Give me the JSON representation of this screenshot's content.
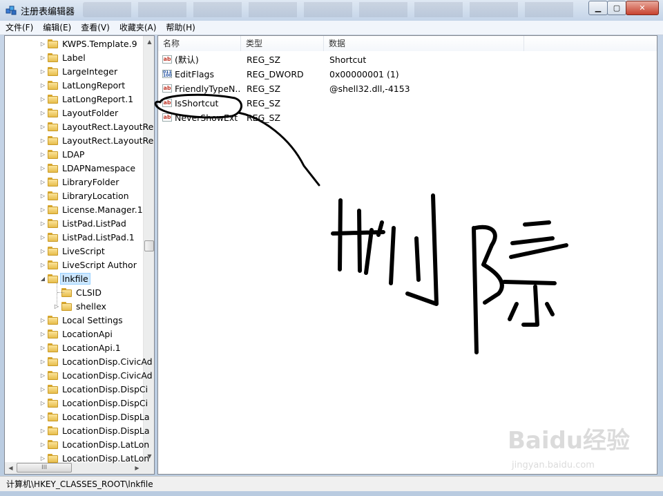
{
  "window": {
    "title": "注册表编辑器",
    "controls": {
      "minimize": "▁",
      "maximize": "▢",
      "close": "✕"
    }
  },
  "menu": [
    "文件(F)",
    "编辑(E)",
    "查看(V)",
    "收藏夹(A)",
    "帮助(H)"
  ],
  "tree": {
    "items": [
      {
        "label": "KWPS.Template.9"
      },
      {
        "label": "Label"
      },
      {
        "label": "LargeInteger"
      },
      {
        "label": "LatLongReport"
      },
      {
        "label": "LatLongReport.1"
      },
      {
        "label": "LayoutFolder"
      },
      {
        "label": "LayoutRect.LayoutRe"
      },
      {
        "label": "LayoutRect.LayoutRe"
      },
      {
        "label": "LDAP"
      },
      {
        "label": "LDAPNamespace"
      },
      {
        "label": "LibraryFolder"
      },
      {
        "label": "LibraryLocation"
      },
      {
        "label": "License.Manager.1"
      },
      {
        "label": "ListPad.ListPad"
      },
      {
        "label": "ListPad.ListPad.1"
      },
      {
        "label": "LiveScript"
      },
      {
        "label": "LiveScript Author"
      },
      {
        "label": "lnkfile"
      },
      {
        "label": "CLSID"
      },
      {
        "label": "shellex"
      },
      {
        "label": "Local Settings"
      },
      {
        "label": "LocationApi"
      },
      {
        "label": "LocationApi.1"
      },
      {
        "label": "LocationDisp.CivicAd"
      },
      {
        "label": "LocationDisp.CivicAd"
      },
      {
        "label": "LocationDisp.DispCi"
      },
      {
        "label": "LocationDisp.DispCi"
      },
      {
        "label": "LocationDisp.DispLa"
      },
      {
        "label": "LocationDisp.DispLa"
      },
      {
        "label": "LocationDisp.LatLon"
      },
      {
        "label": "LocationDisp.LatLon"
      }
    ],
    "hscroll_thumb": "III"
  },
  "list": {
    "headers": [
      "名称",
      "类型",
      "数据"
    ],
    "rows": [
      {
        "icon": "ab",
        "name": "(默认)",
        "type": "REG_SZ",
        "data": "Shortcut"
      },
      {
        "icon": "bin",
        "name": "EditFlags",
        "type": "REG_DWORD",
        "data": "0x00000001 (1)"
      },
      {
        "icon": "ab",
        "name": "FriendlyTypeN...",
        "type": "REG_SZ",
        "data": "@shell32.dll,-4153"
      },
      {
        "icon": "ab",
        "name": "IsShortcut",
        "type": "REG_SZ",
        "data": ""
      },
      {
        "icon": "ab",
        "name": "NeverShowExt",
        "type": "REG_SZ",
        "data": ""
      }
    ]
  },
  "status": {
    "path": "计算机\\HKEY_CLASSES_ROOT\\lnkfile"
  },
  "watermark": {
    "text": "Baidu经验",
    "sub": "jingyan.baidu.com"
  },
  "colors": {
    "selection": "#cde8ff",
    "title_bg": "#c4d4e8",
    "annotation_ink": "#000000"
  }
}
